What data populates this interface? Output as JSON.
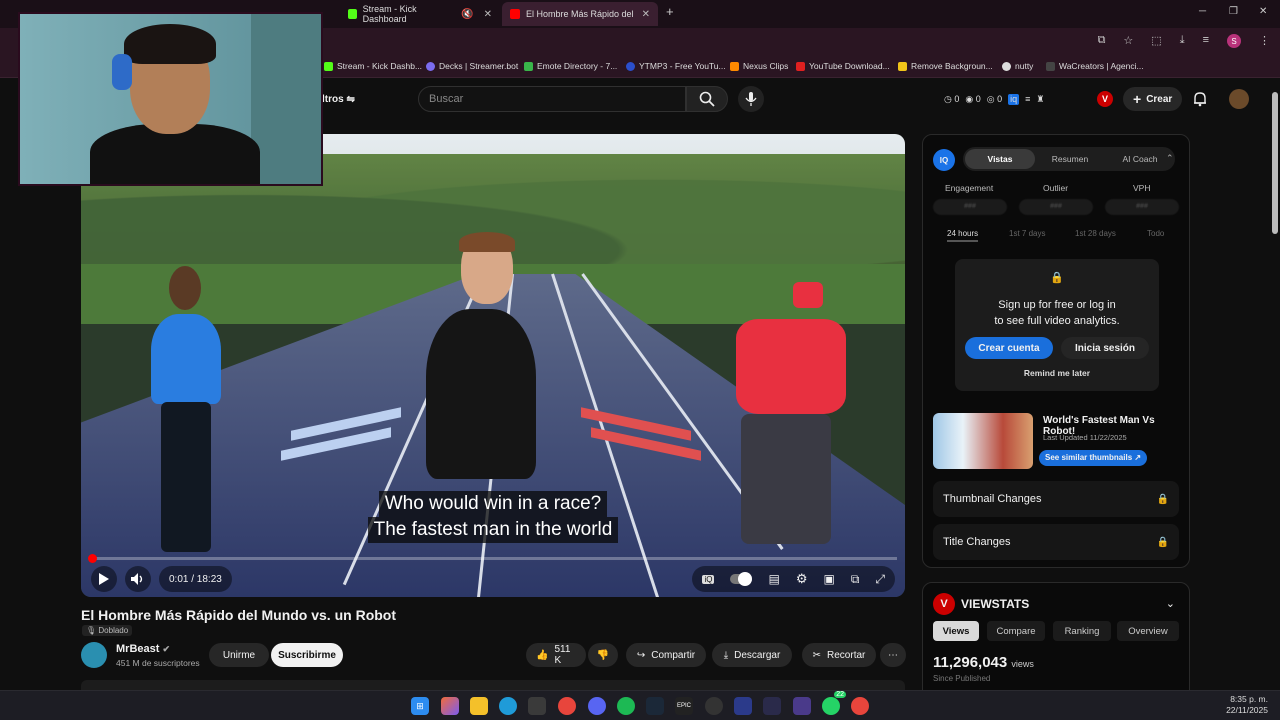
{
  "browser": {
    "tabs": [
      {
        "label": "Stream - Kick Dashboard",
        "active": false
      },
      {
        "label": "El Hombre Más Rápido del Mu",
        "active": true
      }
    ],
    "new_tab": "+",
    "bookmarks": [
      "Stream - Kick Dashb...",
      "Decks | Streamer.bot",
      "Emote Directory - 7...",
      "YTMP3 - Free YouTu...",
      "Nexus Clips",
      "YouTube Download...",
      "Remove Backgroun...",
      "nutty",
      "WaCreators | Agenci..."
    ],
    "profile_initial": "S"
  },
  "header": {
    "filters_label": "ltros",
    "search_placeholder": "Buscar",
    "mini_stats": [
      "0",
      "0",
      "0"
    ],
    "create_label": "Crear",
    "vidiq_badge": "V"
  },
  "player": {
    "subtitle_line1": "Who would win in a race?",
    "subtitle_line2": "The fastest man in the world",
    "time": "0:01 / 18:23",
    "progress_fraction": 0.001
  },
  "video": {
    "title": "El Hombre Más Rápido del Mundo vs. un Robot",
    "dubbed_label": "Doblado",
    "channel_name": "MrBeast",
    "subscribers": "451 M de suscriptores",
    "join_label": "Unirme",
    "subscribe_label": "Suscribirme",
    "likes": "511 K",
    "share_label": "Compartir",
    "download_label": "Descargar",
    "clip_label": "Recortar"
  },
  "analytics": {
    "iq_label": "IQ",
    "tabs": [
      "Vistas",
      "Resumen",
      "AI Coach"
    ],
    "metrics": [
      "Engagement",
      "Outlier",
      "VPH"
    ],
    "metric_placeholder": "###",
    "ranges": [
      "24 hours",
      "1st 7 days",
      "1st 28 days",
      "Todo"
    ],
    "lock_line1": "Sign up for free or log in",
    "lock_line2": "to see full video analytics.",
    "create_account": "Crear cuenta",
    "login": "Inicia sesión",
    "remind": "Remind me later",
    "thumb_title": "World's Fastest Man Vs Robot!",
    "thumb_updated": "Last Updated 11/22/2025",
    "similar_thumbs": "See similar thumbnails ↗",
    "thumbnail_changes": "Thumbnail Changes",
    "title_changes": "Title Changes"
  },
  "viewstats": {
    "title": "VIEWSTATS",
    "tabs": [
      "Views",
      "Compare",
      "Ranking",
      "Overview"
    ],
    "views_number": "11,296,043",
    "views_unit": "views",
    "since": "Since Published"
  },
  "taskbar": {
    "time": "8:35 p. m.",
    "date": "22/11/2025",
    "badge_count": "22"
  }
}
